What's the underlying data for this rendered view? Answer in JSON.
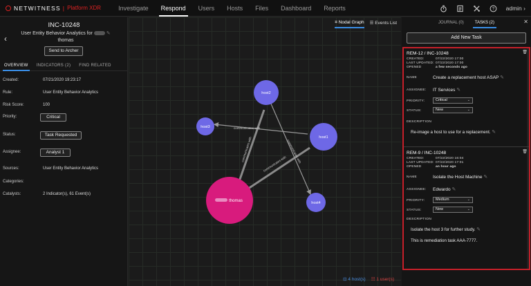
{
  "topbar": {
    "brand": "NETWITNESS",
    "product": "Platform XDR",
    "nav": [
      "Investigate",
      "Respond",
      "Users",
      "Hosts",
      "Files",
      "Dashboard",
      "Reports"
    ],
    "active_nav": "Respond",
    "user": "admin"
  },
  "incident": {
    "id": "INC-10248",
    "title_prefix": "User Entity Behavior Analytics for",
    "title_suffix": "thomas",
    "send_button": "Send to Archer",
    "tabs": [
      "OVERVIEW",
      "INDICATORS (2)",
      "FIND RELATED"
    ],
    "fields": [
      {
        "label": "Created:",
        "value": "07/21/2020 19:23:17"
      },
      {
        "label": "Rule:",
        "value": "User Entity Behavior Analytics"
      },
      {
        "label": "Risk Score:",
        "value": "100"
      },
      {
        "label": "Priority:",
        "value": "Critical"
      },
      {
        "label": "Status:",
        "value": "Task Requested"
      },
      {
        "label": "Assignee:",
        "value": "Analyst 1"
      },
      {
        "label": "Sources:",
        "value": "User Entity Behavior Analytics"
      },
      {
        "label": "Categories:",
        "value": ""
      },
      {
        "label": "Catalysts:",
        "value": "2 Indicator(s), 61 Event(s)"
      }
    ]
  },
  "graph": {
    "view_tabs": [
      "Nodal Graph",
      "Events List"
    ],
    "nodes": {
      "host1": "host1",
      "host2": "host2",
      "host3": "host3",
      "host4": "host4",
      "user": "thomas"
    },
    "edge_label": "communicates with",
    "hosts_count": "4 host(s)",
    "users_count": "1 user(s)"
  },
  "panel": {
    "tabs": [
      "JOURNAL (0)",
      "TASKS (2)"
    ],
    "add_task": "Add New Task",
    "labels": {
      "created": "CREATED:",
      "last_updated": "LAST UPDATED:",
      "opened": "OPENED",
      "name": "NAME",
      "assignee": "ASSIGNEE:",
      "priority": "PRIORITY:",
      "status": "STATUS:",
      "description": "DESCRIPTION"
    },
    "tasks": [
      {
        "id": "REM-12  /  INC-10248",
        "created": "07/22/2020 17:00",
        "last_updated": "07/22/2020 17:00",
        "opened": "a few seconds ago",
        "name": "Create a replacement host ASAP",
        "assignee": "IT Services",
        "priority": "Critical",
        "status": "New",
        "description": [
          "Re-image a host to use for a replacement."
        ]
      },
      {
        "id": "REM-9  /  INC-10248",
        "created": "07/22/2020 16:04",
        "last_updated": "07/22/2020 17:01",
        "opened": "an hour ago",
        "name": "Isolate the Host Machine",
        "assignee": "Edwardo",
        "priority": "Medium",
        "status": "New",
        "description": [
          "Isolate the host 3 for further study.",
          "This is remediation task AAA-7777."
        ]
      }
    ]
  },
  "colors": {
    "accent": "#3a8ee6",
    "brand_red": "#d22222",
    "host_node": "#6e68e6",
    "user_node": "#d81b7d",
    "highlight_border": "#c8202a"
  }
}
